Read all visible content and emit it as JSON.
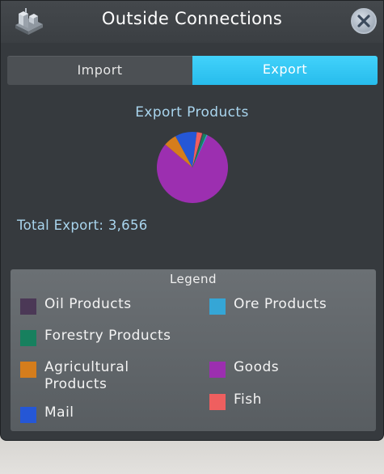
{
  "window": {
    "title": "Outside Connections",
    "icon": "city-buildings-icon",
    "close_icon": "close-icon"
  },
  "tabs": [
    {
      "label": "Import",
      "active": false
    },
    {
      "label": "Export",
      "active": true
    }
  ],
  "chart": {
    "title": "Export Products"
  },
  "chart_data": {
    "type": "pie",
    "title": "Export Products",
    "slices": [
      {
        "label": "Goods",
        "value": 0.8,
        "color": "#9c2fb0"
      },
      {
        "label": "Agricultural Products",
        "value": 0.06,
        "color": "#d57d1c"
      },
      {
        "label": "Mail",
        "value": 0.1,
        "color": "#2557d6"
      },
      {
        "label": "Fish",
        "value": 0.025,
        "color": "#ef5f5f"
      },
      {
        "label": "Oil Products",
        "value": 0.005,
        "color": "#4b3856"
      },
      {
        "label": "Forestry Products",
        "value": 0.015,
        "color": "#17805e"
      },
      {
        "label": "Ore Products",
        "value": 0.005,
        "color": "#35a6d6"
      }
    ]
  },
  "total": {
    "label": "Total Export:",
    "value": "3,656"
  },
  "legend": {
    "title": "Legend",
    "items": [
      {
        "label": "Oil Products",
        "color": "#4b3856"
      },
      {
        "label": "Ore Products",
        "color": "#35a6d6"
      },
      {
        "label": "Forestry Products",
        "color": "#17805e"
      },
      {
        "label": "Agricultural Products",
        "label_line1": "Agricultural",
        "label_line2": "Products",
        "color": "#d57d1c"
      },
      {
        "label": "Goods",
        "color": "#9c2fb0"
      },
      {
        "label": "Mail",
        "color": "#2557d6"
      },
      {
        "label": "Fish",
        "color": "#ef5f5f"
      }
    ]
  }
}
